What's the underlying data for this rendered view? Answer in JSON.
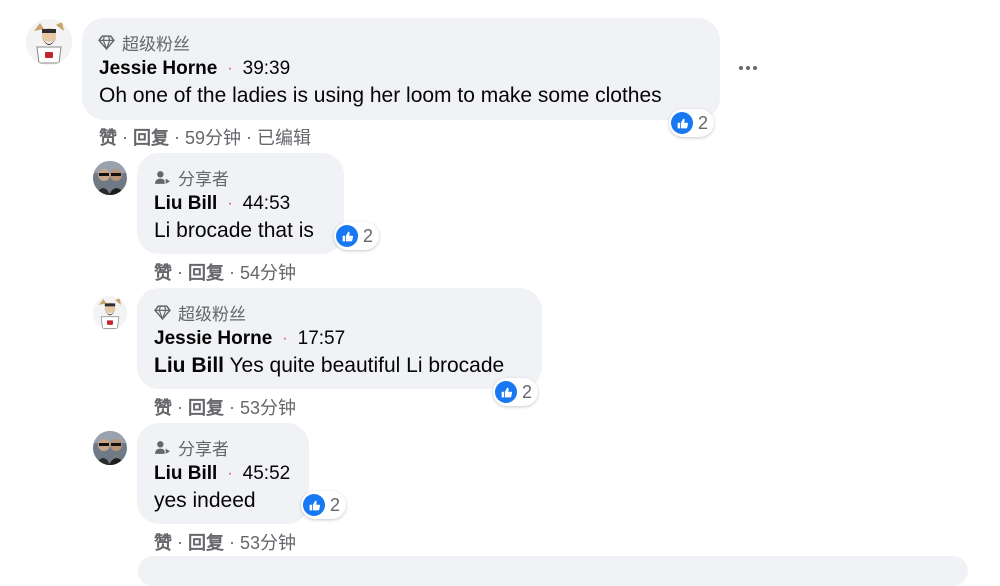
{
  "labels": {
    "superfan": "超级粉丝",
    "sharer": "分享者",
    "like": "赞",
    "reply": "回复",
    "edited": "已编辑",
    "separator": "·"
  },
  "comments": [
    {
      "author": "Jessie Horne",
      "timestamp": "39:39",
      "text": "Oh one of the ladies is using her loom to make some clothes",
      "reactions": "2",
      "age": "59分钟",
      "avatar": "cartoon-avatar"
    },
    {
      "author": "Liu Bill",
      "timestamp": "44:53",
      "text": "Li brocade that is",
      "reactions": "2",
      "age": "54分钟",
      "avatar": "photo-avatar"
    },
    {
      "author": "Jessie Horne",
      "timestamp": "17:57",
      "mention": "Liu Bill",
      "text": " Yes quite beautiful Li brocade",
      "reactions": "2",
      "age": "53分钟",
      "avatar": "cartoon-avatar"
    },
    {
      "author": "Liu Bill",
      "timestamp": "45:52",
      "text": "yes indeed",
      "reactions": "2",
      "age": "53分钟",
      "avatar": "photo-avatar"
    }
  ],
  "icons": {
    "superfan_badge": "diamond-icon",
    "sharer_badge": "person-share-icon",
    "reaction": "thumbs-up-icon",
    "more": "more-horizontal-icon"
  },
  "colors": {
    "bubble": "#f0f2f5",
    "like_blue": "#1877f2",
    "secondary_text": "#65676b",
    "timestamp_dot": "#e04a5a"
  }
}
